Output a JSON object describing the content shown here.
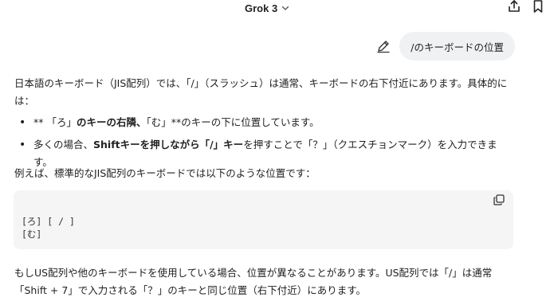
{
  "header": {
    "model_label": "Grok 3"
  },
  "icons": {
    "model_dropdown": "chevron-down-icon",
    "share": "share-icon",
    "bookmark": "bookmark-icon",
    "edit": "edit-icon",
    "copy": "copy-icon"
  },
  "user_message": {
    "text": "/のキーボードの位置"
  },
  "response": {
    "intro": "日本語のキーボード（JIS配列）では、「/」（スラッシュ）は通常、キーボードの右下付近にあります。具体的には：",
    "bullets": [
      {
        "parts": [
          "** 「ろ」",
          "のキーの右隣、",
          "「む」**のキーの下に位置しています。"
        ]
      },
      {
        "parts": [
          "多くの場合、",
          "Shiftキーを押しながら「/」キー",
          "を押すことで「？」（クエスチョンマーク）を入力できます。"
        ]
      }
    ],
    "example_intro": "例えば、標準的なJIS配列のキーボードでは以下のような位置です：",
    "code_lines": [
      "[ろ] [ / ]",
      "[む]"
    ],
    "closing": "もしUS配列や他のキーボードを使用している場合、位置が異なることがあります。US配列では「/」は通常「Shift + 7」で入力される「？」のキーと同じ位置（右下付近）にあります。"
  }
}
